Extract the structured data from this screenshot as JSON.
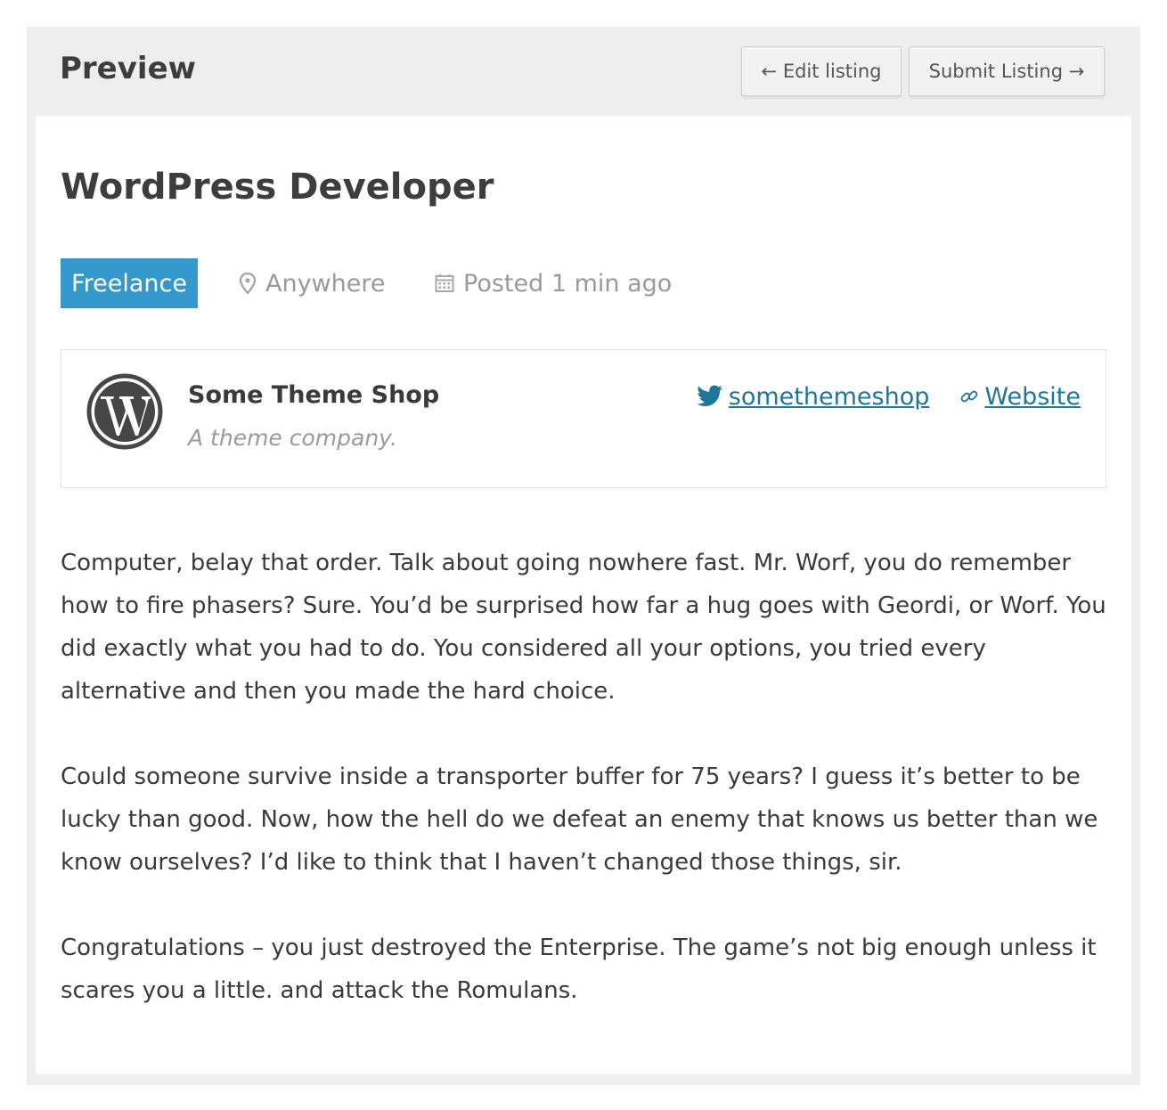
{
  "header": {
    "title": "Preview",
    "edit_button": {
      "arrow": "←",
      "label": "Edit listing"
    },
    "submit_button": {
      "label": "Submit Listing",
      "arrow": "→"
    }
  },
  "job": {
    "title": "WordPress Developer",
    "type_badge": "Freelance",
    "location": "Anywhere",
    "posted": "Posted 1 min ago"
  },
  "company": {
    "name": "Some Theme Shop",
    "tagline": "A theme company.",
    "twitter": "somethemeshop",
    "website": "Website"
  },
  "description": [
    "Computer, belay that order. Talk about going nowhere fast. Mr. Worf, you do remember how to fire phasers? Sure. You’d be surprised how far a hug goes with Geordi, or Worf. You did exactly what you had to do. You considered all your options, you tried every alternative and then you made the hard choice.",
    "Could someone survive inside a transporter buffer for 75 years? I guess it’s better to be lucky than good. Now, how the hell do we defeat an enemy that knows us better than we know ourselves? I’d like to think that I haven’t changed those things, sir.",
    "Congratulations – you just destroyed the Enterprise. The game’s not big enough unless it scares you a little. and attack the Romulans."
  ],
  "icons": {
    "location": "map-pin-icon",
    "date": "calendar-icon",
    "twitter": "twitter-bird-icon",
    "website": "link-chain-icon",
    "logo": "wordpress-logo-icon"
  },
  "colors": {
    "badge": "#3399cc",
    "link": "#21759b",
    "frame": "#eeeeee",
    "muted": "#9a9a9a"
  }
}
